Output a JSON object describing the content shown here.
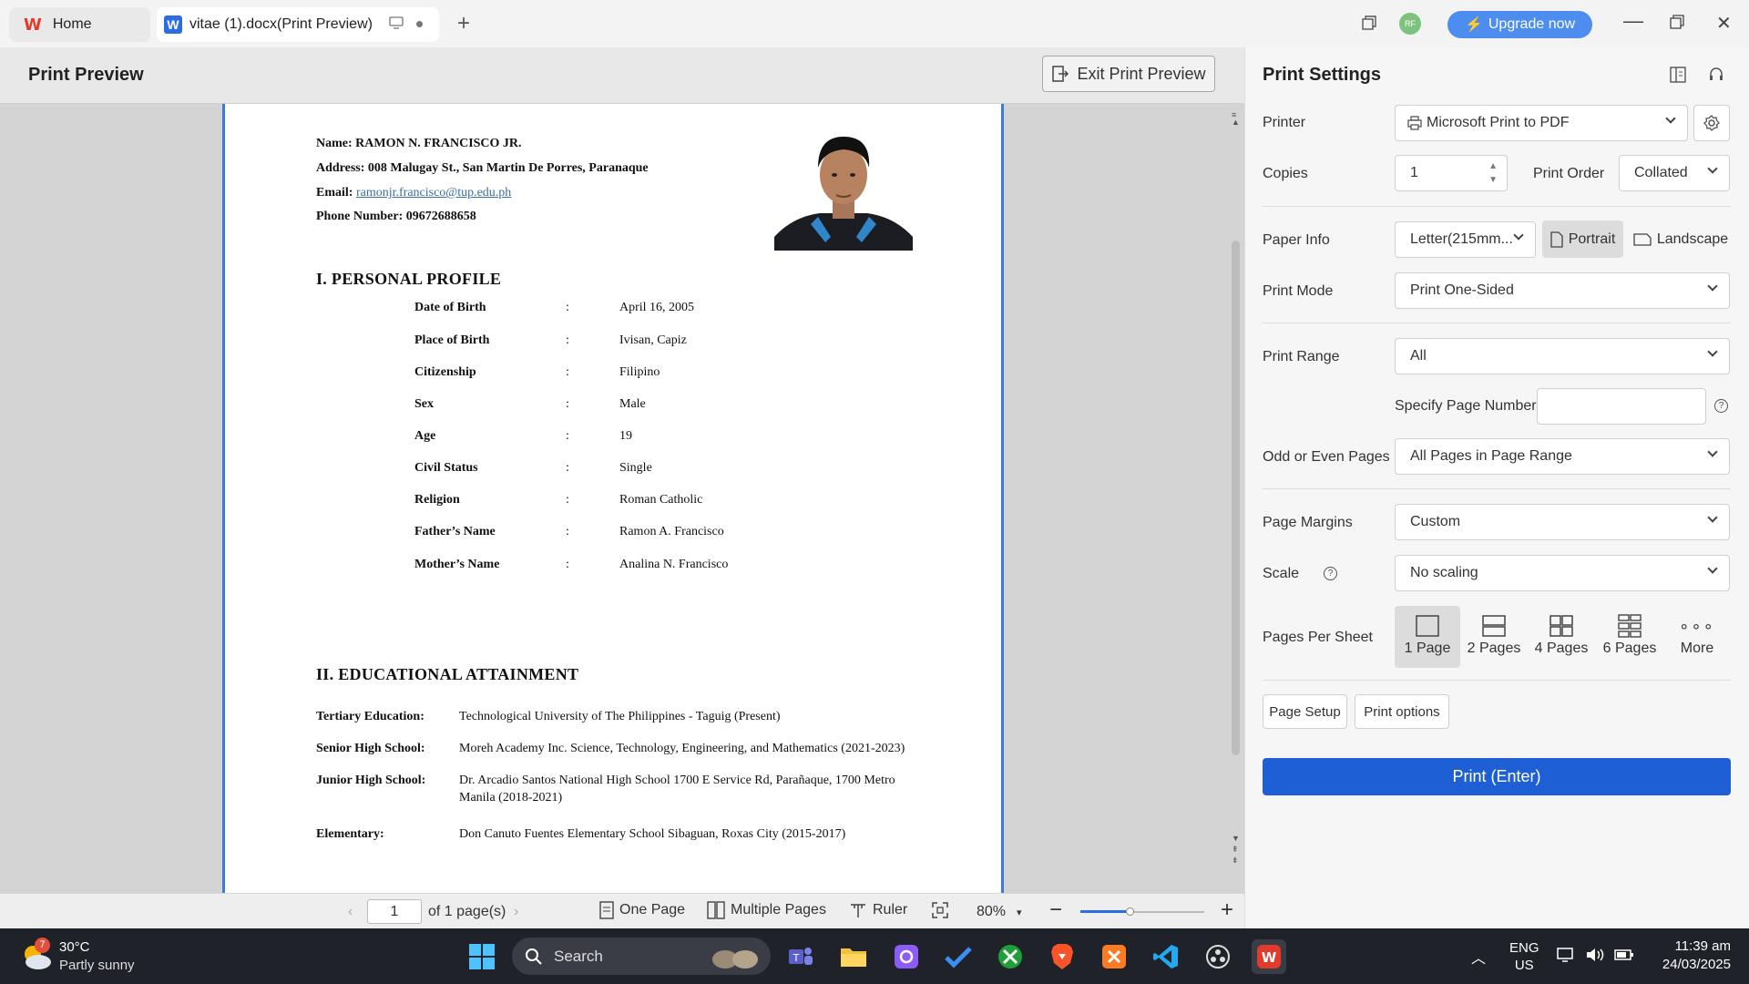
{
  "tabs": {
    "home": "Home",
    "doc": "vitae (1).docx(Print Preview)"
  },
  "titlebar": {
    "avatar": "RF",
    "upgrade": "Upgrade now"
  },
  "preview": {
    "title": "Print Preview",
    "exit_label": "Exit Print Preview"
  },
  "document": {
    "name_label": "Name:",
    "name_value": "RAMON N. FRANCISCO JR.",
    "address_label": "Address:",
    "address_value": "008 Malugay St., San Martin De Porres, Paranaque",
    "email_label": "Email:",
    "email_value": "ramonjr.francisco@tup.edu.ph",
    "phone_label": "Phone Number:",
    "phone_value": "09672688658",
    "section1": "I. PERSONAL PROFILE",
    "profile": [
      {
        "label": "Date of Birth",
        "value": "April 16, 2005"
      },
      {
        "label": "Place of Birth",
        "value": "Ivisan, Capiz"
      },
      {
        "label": "Citizenship",
        "value": "Filipino"
      },
      {
        "label": "Sex",
        "value": "Male"
      },
      {
        "label": "Age",
        "value": "19"
      },
      {
        "label": "Civil Status",
        "value": "Single"
      },
      {
        "label": "Religion",
        "value": "Roman Catholic"
      },
      {
        "label": "Father’s Name",
        "value": "Ramon A. Francisco"
      },
      {
        "label": "Mother’s Name",
        "value": "Analina N. Francisco"
      }
    ],
    "colon": ":",
    "section2": "II. EDUCATIONAL ATTAINMENT",
    "education": [
      {
        "label": "Tertiary Education:",
        "value": "Technological University of The Philippines - Taguig  (Present)",
        "value2": ""
      },
      {
        "label": "Senior High School:",
        "value": "Moreh Academy Inc.  Science, Technology, Engineering, and Mathematics (2021-2023)",
        "value2": ""
      },
      {
        "label": "Junior High School:",
        "value": "Dr. Arcadio Santos National High School 1700 E Service Rd, Parañaque, 1700 Metro",
        "value2": "Manila (2018-2021)"
      },
      {
        "label": "Elementary:",
        "value": "Don Canuto Fuentes Elementary School Sibaguan, Roxas City (2015-2017)",
        "value2": ""
      }
    ]
  },
  "bottom": {
    "page": "1",
    "of_pages": "of 1 page(s)",
    "one_page": "One Page",
    "multiple_pages": "Multiple Pages",
    "ruler": "Ruler",
    "zoom": "80%"
  },
  "settings": {
    "title": "Print Settings",
    "printer_label": "Printer",
    "printer_value": "Microsoft Print to PDF",
    "copies_label": "Copies",
    "copies_value": "1",
    "order_label": "Print Order",
    "order_value": "Collated",
    "paper_label": "Paper Info",
    "paper_value": "Letter(215mm...",
    "portrait": "Portrait",
    "landscape": "Landscape",
    "mode_label": "Print Mode",
    "mode_value": "Print One-Sided",
    "range_label": "Print Range",
    "range_value": "All",
    "specify_label": "Specify Page Number",
    "oddeven_label": "Odd or Even Pages",
    "oddeven_value": "All Pages in Page Range",
    "margins_label": "Page Margins",
    "margins_value": "Custom",
    "scale_label": "Scale",
    "scale_value": "No scaling",
    "pps_label": "Pages Per Sheet",
    "pps_options": [
      "1 Page",
      "2 Pages",
      "4 Pages",
      "6 Pages",
      "More"
    ],
    "page_setup": "Page Setup",
    "print_options": "Print options",
    "print_button": "Print (Enter)"
  },
  "taskbar": {
    "weather_temp": "30°C",
    "weather_desc": "Partly sunny",
    "weather_badge": "7",
    "search": "Search",
    "lang1": "ENG",
    "lang2": "US",
    "time": "11:39 am",
    "date": "24/03/2025"
  },
  "colors": {
    "accent": "#1f5fd6",
    "upgrade": "#4d8df0",
    "page_border": "#3b7be0",
    "taskbar": "#1f2229"
  }
}
